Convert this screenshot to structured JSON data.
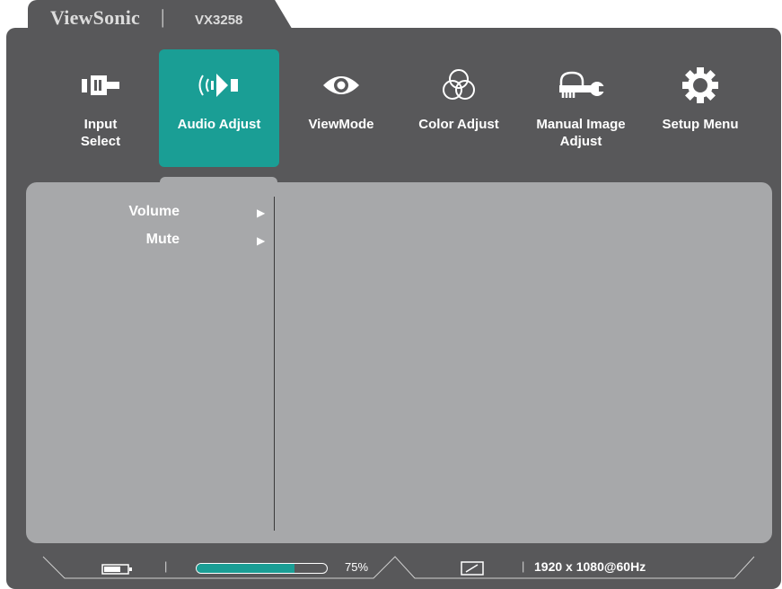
{
  "header": {
    "brand": "ViewSonic",
    "separator": "|",
    "model": "VX3258"
  },
  "menu": {
    "items": [
      {
        "label_line1": "Input",
        "label_line2": "Select",
        "icon": "input-select-icon"
      },
      {
        "label_line1": "Audio Adjust",
        "label_line2": "",
        "icon": "speaker-icon",
        "active": true
      },
      {
        "label_line1": "ViewMode",
        "label_line2": "",
        "icon": "eye-icon"
      },
      {
        "label_line1": "Color Adjust",
        "label_line2": "",
        "icon": "color-circles-icon"
      },
      {
        "label_line1": "Manual Image",
        "label_line2": "Adjust",
        "icon": "hand-wrench-icon"
      },
      {
        "label_line1": "Setup Menu",
        "label_line2": "",
        "icon": "gear-icon"
      }
    ]
  },
  "submenu": {
    "items": [
      {
        "label": "Volume",
        "arrow": "▶"
      },
      {
        "label": "Mute",
        "arrow": "▶"
      }
    ]
  },
  "status": {
    "battery_icon": "battery-icon",
    "separator": "|",
    "progress_value": 0.75,
    "progress_label": "75%",
    "signal_icon": "signal-box-icon",
    "resolution": "1920 x 1080@60Hz"
  },
  "colors": {
    "accent": "#1a9e95",
    "frame": "#58585a",
    "panel": "#a7a8aa"
  }
}
